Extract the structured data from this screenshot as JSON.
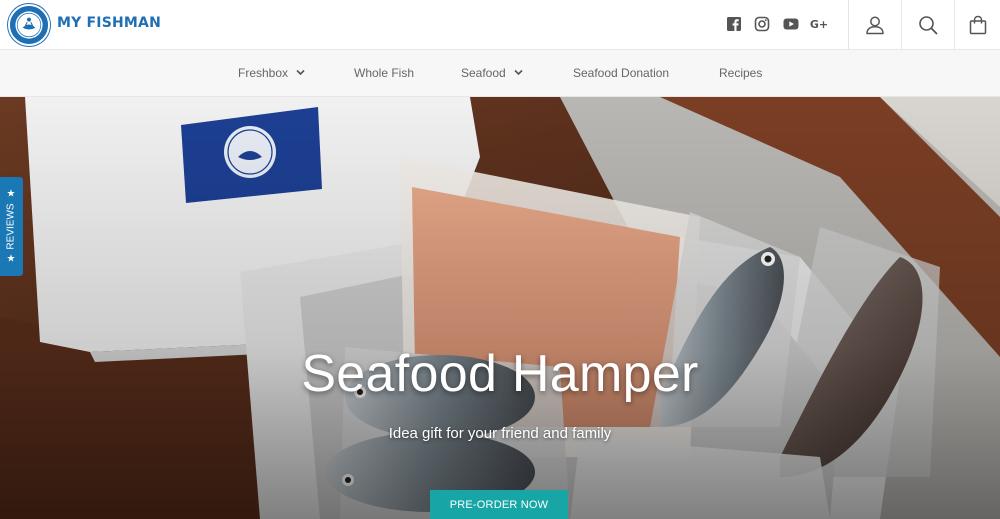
{
  "brand": {
    "name": "MY FISHMAN",
    "color": "#1f6fb4"
  },
  "header": {
    "social_icons": [
      "facebook-icon",
      "instagram-icon",
      "youtube-icon",
      "google-plus-icon"
    ],
    "google_plus_label": "G+",
    "action_icons": [
      "account-icon",
      "search-icon",
      "cart-icon"
    ]
  },
  "nav": {
    "items": [
      {
        "label": "Freshbox",
        "has_dropdown": true
      },
      {
        "label": "Whole Fish",
        "has_dropdown": false
      },
      {
        "label": "Seafood",
        "has_dropdown": true
      },
      {
        "label": "Seafood Donation",
        "has_dropdown": false
      },
      {
        "label": "Recipes",
        "has_dropdown": false
      }
    ]
  },
  "hero": {
    "title": "Seafood Hamper",
    "subtitle": "Idea gift for your friend and family",
    "cta_label": "PRE-ORDER NOW",
    "cta_color": "#17a5a5"
  },
  "reviews_tab": {
    "label": "REVIEWS",
    "color": "#1a78b4"
  }
}
